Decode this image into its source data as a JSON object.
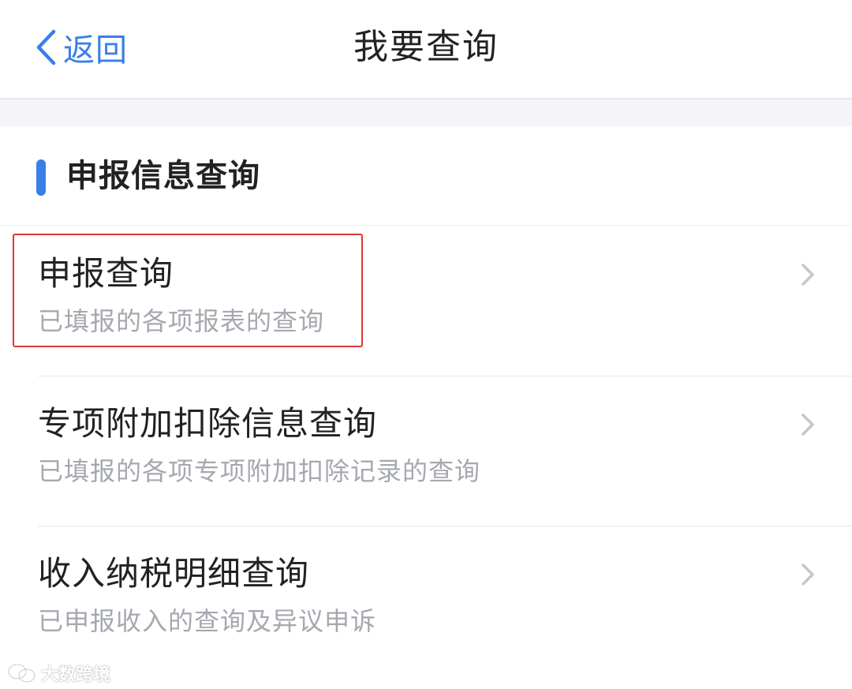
{
  "nav": {
    "back_label": "返回",
    "title": "我要查询"
  },
  "section": {
    "title": "申报信息查询"
  },
  "items": [
    {
      "title": "申报查询",
      "desc": "已填报的各项报表的查询"
    },
    {
      "title": "专项附加扣除信息查询",
      "desc": "已填报的各项专项附加扣除记录的查询"
    },
    {
      "title": "收入纳税明细查询",
      "desc": "已申报收入的查询及异议申诉"
    }
  ],
  "watermark": {
    "text": "大数跨境"
  },
  "colors": {
    "accent": "#3a7ee8",
    "highlight": "#d93a36",
    "title_text": "#222222",
    "secondary_text": "#a5a8af",
    "page_background": "#f4f5f9"
  },
  "icons": {
    "back": "chevron-left-icon",
    "row_arrow": "chevron-right-icon",
    "watermark_logo": "wechat-logo-icon"
  }
}
